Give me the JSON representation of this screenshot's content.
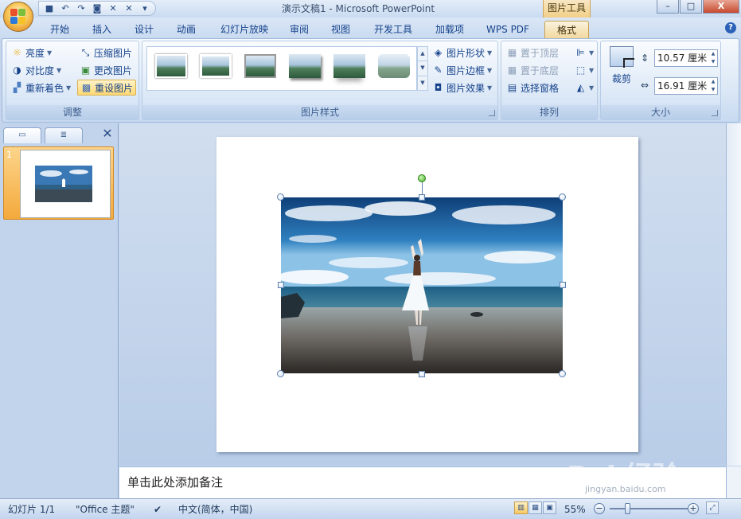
{
  "window": {
    "title": "演示文稿1 - Microsoft PowerPoint",
    "context_tab_title": "图片工具",
    "controls": {
      "minimize": "–",
      "maximize": "□",
      "close": "X"
    }
  },
  "qat": {
    "save": "save-icon",
    "undo": "undo-icon",
    "redo": "redo-icon"
  },
  "tabs": [
    {
      "label": "开始"
    },
    {
      "label": "插入"
    },
    {
      "label": "设计"
    },
    {
      "label": "动画"
    },
    {
      "label": "幻灯片放映"
    },
    {
      "label": "审阅"
    },
    {
      "label": "视图"
    },
    {
      "label": "开发工具"
    },
    {
      "label": "加载项"
    },
    {
      "label": "WPS PDF"
    },
    {
      "label": "格式",
      "active": true
    }
  ],
  "ribbon": {
    "adjust": {
      "label": "调整",
      "brightness": "亮度",
      "contrast": "对比度",
      "recolor": "重新着色",
      "compress": "压缩图片",
      "change_picture": "更改图片",
      "reset_picture": "重设图片"
    },
    "styles": {
      "label": "图片样式",
      "shape": "图片形状",
      "border": "图片边框",
      "effects": "图片效果",
      "thumbnail_count": 6
    },
    "arrange": {
      "label": "排列",
      "bring_front": "置于顶层",
      "send_back": "置于底层",
      "selection_pane": "选择窗格"
    },
    "size": {
      "label": "大小",
      "crop": "裁剪",
      "height": "10.57 厘米",
      "width": "16.91 厘米"
    }
  },
  "slides_panel": {
    "slide_number": "1"
  },
  "notes": {
    "placeholder": "单击此处添加备注"
  },
  "statusbar": {
    "slide_info": "幻灯片 1/1",
    "theme": "\"Office 主题\"",
    "language": "中文(简体，中国)",
    "zoom": "55%",
    "zoom_level": 0.55
  },
  "watermark": {
    "text": "Bai 经验",
    "url": "jingyan.baidu.com"
  },
  "colors": {
    "ribbon_bg": "#dce8f6",
    "active_tab": "#f1d89e",
    "accent_text": "#15428b"
  }
}
